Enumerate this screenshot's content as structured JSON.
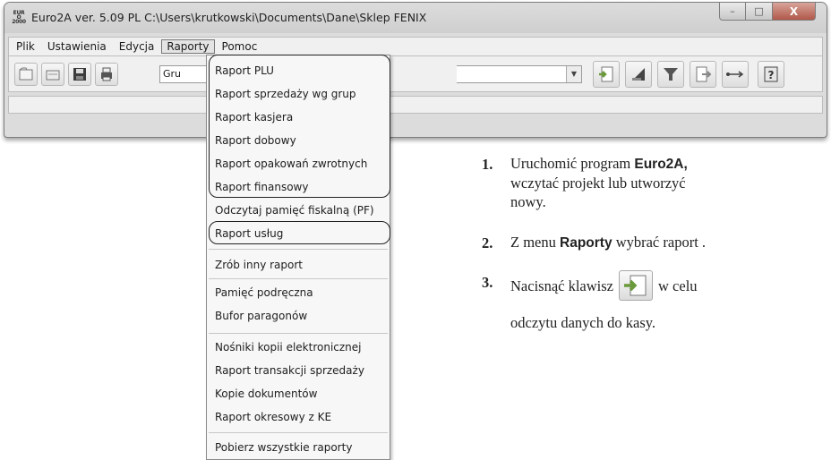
{
  "window": {
    "title": "Euro2A ver. 5.09 PL   C:\\Users\\krutkowski\\Documents\\Dane\\Sklep FENIX",
    "icon_text": "EURO 2000",
    "minimize_glyph": "–",
    "maximize_glyph": "□",
    "close_glyph": "X"
  },
  "menubar": {
    "items": [
      "Plik",
      "Ustawienia",
      "Edycja",
      "Raporty",
      "Pomoc"
    ],
    "active": "Raporty"
  },
  "toolbar": {
    "combo_value": "Gru",
    "left_buttons": [
      "new-file-icon",
      "open-file-icon",
      "save-icon",
      "print-icon"
    ],
    "right_buttons": [
      "read-from-register-icon",
      "send-icon",
      "filter-icon",
      "export-icon",
      "usb-icon",
      "help-icon"
    ]
  },
  "raporty_menu": {
    "items": [
      "Raport PLU",
      "Raport sprzedaży wg grup",
      "Raport kasjera",
      "Raport dobowy",
      "Raport opakowań zwrotnych",
      "Raport finansowy",
      "Odczytaj pamięć fiskalną (PF)",
      "Raport usług",
      "Zrób inny raport",
      "Pamięć podręczna",
      "Bufor paragonów",
      "Nośniki kopii elektronicznej",
      "Raport transakcji sprzedaży",
      "Kopie dokumentów",
      "Raport okresowy z KE",
      "Pobierz wszystkie raporty"
    ]
  },
  "instructions": {
    "step1": {
      "num": "1.",
      "pre": "Uruchomić program ",
      "bold": "Euro2A,",
      "line2": "wczytać projekt lub utworzyć",
      "line3": "nowy."
    },
    "step2": {
      "num": "2.",
      "pre": "Z menu ",
      "bold": "Raporty",
      "post": " wybrać raport ."
    },
    "step3": {
      "num": "3.",
      "pre": "Nacisnąć klawisz",
      "post": "w celu",
      "line2": "odczytu danych do kasy."
    }
  },
  "colors": {
    "accent_green": "#6a9a3a",
    "close_red": "#b1584a"
  }
}
